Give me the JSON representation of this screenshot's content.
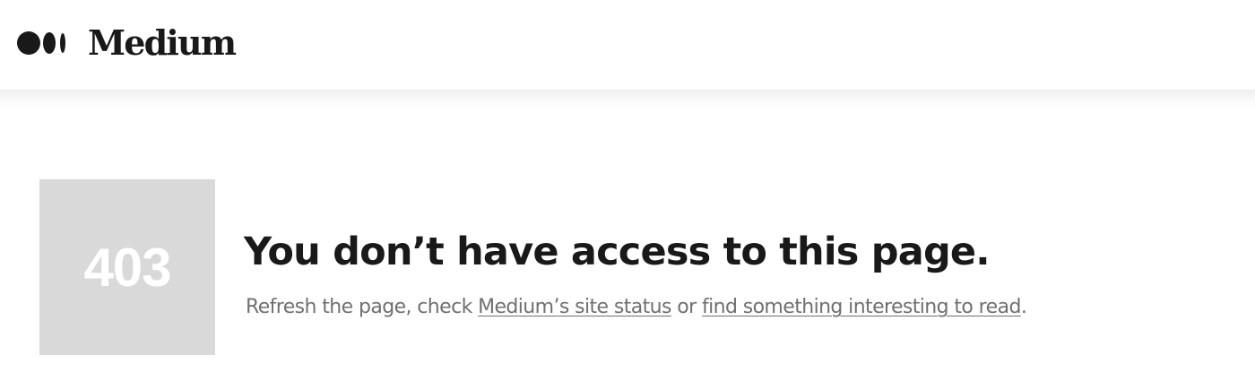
{
  "header": {
    "logo_text": "Medium"
  },
  "error": {
    "code": "403",
    "title": "You don’t have access to this page.",
    "message_prefix": "Refresh the page, check ",
    "site_status_link": "Medium’s site status",
    "message_middle": " or ",
    "find_link": "find something interesting to read",
    "message_suffix": "."
  },
  "colors": {
    "text": "#191919",
    "muted_text": "#707070",
    "error_box": "#d9d9d9",
    "error_code": "#ffffff"
  }
}
